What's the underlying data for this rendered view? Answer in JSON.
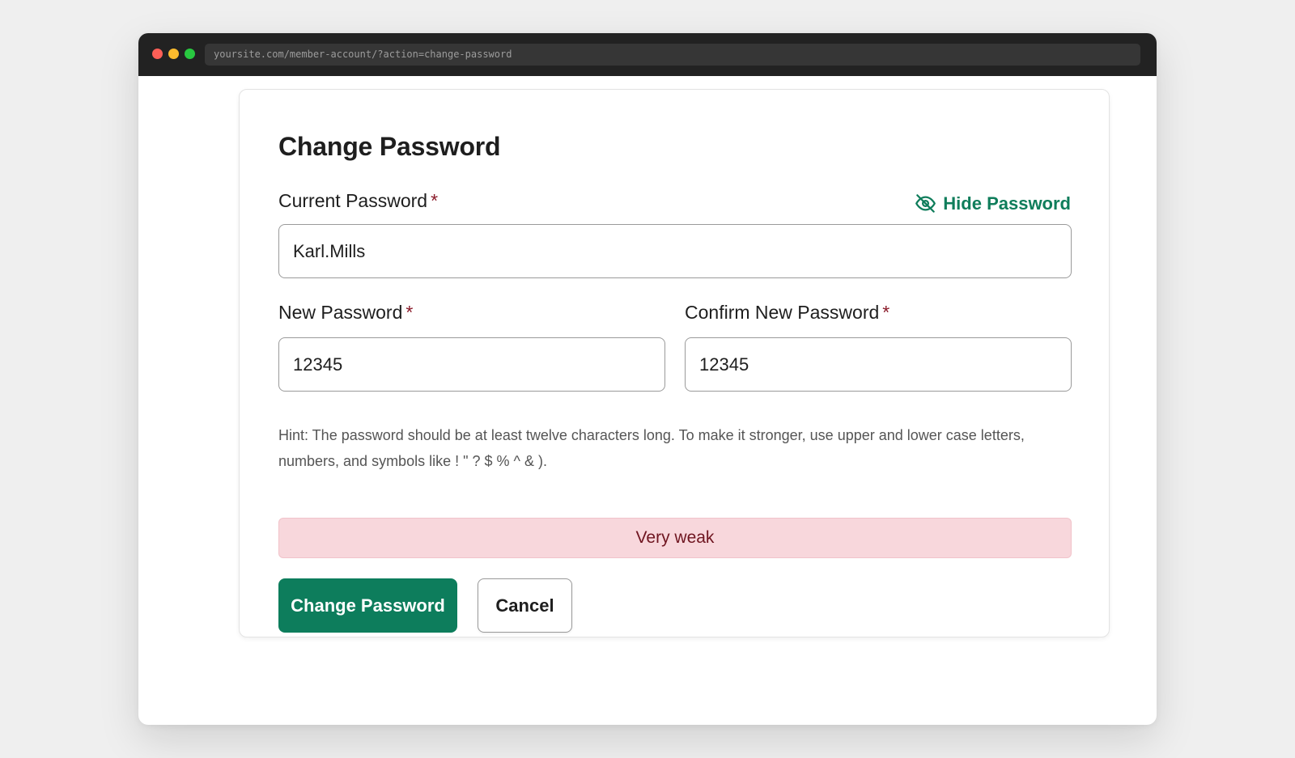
{
  "browser": {
    "url": "yoursite.com/member-account/?action=change-password",
    "dot_colors": [
      "#fe5f57",
      "#febc2e",
      "#28c840"
    ]
  },
  "form": {
    "title": "Change Password",
    "required_marker": "*",
    "toggle_label": "Hide Password",
    "toggle_icon": "eye-slash-icon",
    "current_password": {
      "label": "Current Password",
      "value": "Karl.Mills"
    },
    "new_password": {
      "label": "New Password",
      "value": "12345"
    },
    "confirm_password": {
      "label": "Confirm New Password",
      "value": "12345"
    },
    "hint": "Hint: The password should be at least twelve characters long. To make it stronger, use upper and lower case letters, numbers, and symbols like ! \" ? $ % ^ & ).",
    "strength": "Very weak",
    "submit_label": "Change Password",
    "cancel_label": "Cancel"
  },
  "colors": {
    "accent": "#0d7d5c",
    "weak_bg": "#f8d7dc",
    "weak_text": "#6f1520",
    "required": "#8a1b2a"
  }
}
